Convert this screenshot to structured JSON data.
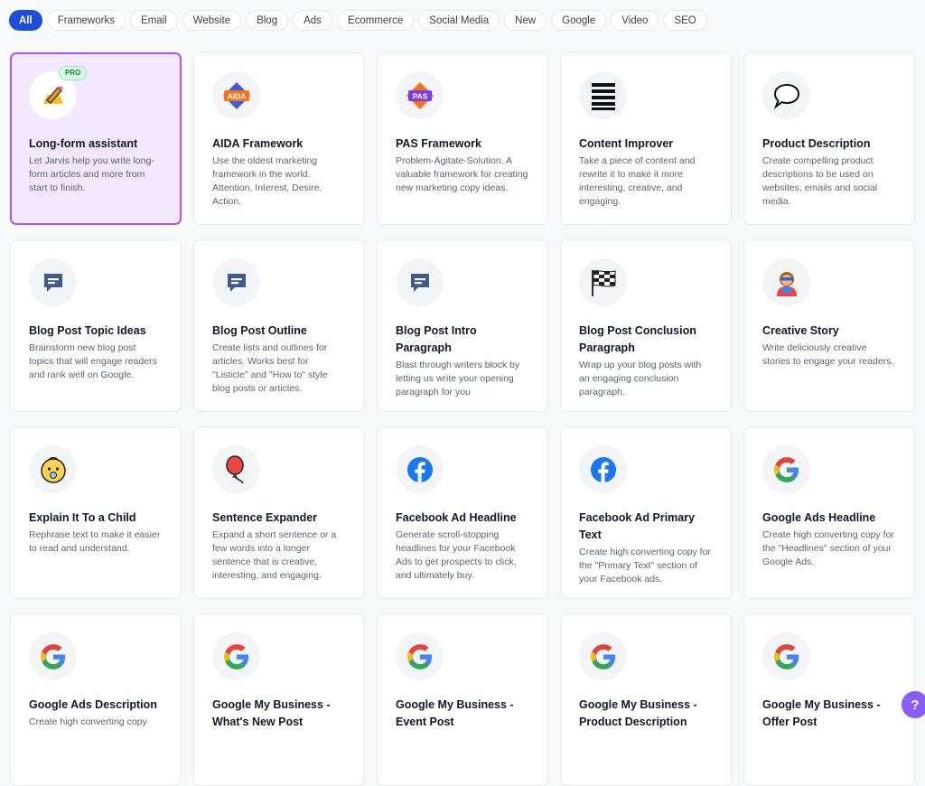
{
  "filters": [
    "All",
    "Frameworks",
    "Email",
    "Website",
    "Blog",
    "Ads",
    "Ecommerce",
    "Social Media",
    "New",
    "Google",
    "Video",
    "SEO"
  ],
  "active_filter": 0,
  "pro_badge": "PRO",
  "help_label": "?",
  "icon_labels": {
    "aida": "AIDA",
    "pas": "PAS"
  },
  "cards": [
    {
      "title": "Long-form assistant",
      "desc": "Let Jarvis help you write long-form articles and more from start to finish.",
      "icon": "pencil-icon",
      "pro": true,
      "selected": true
    },
    {
      "title": "AIDA Framework",
      "desc": "Use the oldest marketing framework in the world. Attention, Interest, Desire, Action.",
      "icon": "aida-icon"
    },
    {
      "title": "PAS Framework",
      "desc": "Problem-Agitate-Solution. A valuable framework for creating new marketing copy ideas.",
      "icon": "pas-icon"
    },
    {
      "title": "Content Improver",
      "desc": "Take a piece of content and rewrite it to make it more interesting, creative, and engaging.",
      "icon": "lines-icon"
    },
    {
      "title": "Product Description",
      "desc": "Create compelling product descriptions to be used on websites, emails and social media.",
      "icon": "speech-bubble-icon"
    },
    {
      "title": "Blog Post Topic Ideas",
      "desc": "Brainstorm new blog post topics that will engage readers and rank well on Google.",
      "icon": "message-icon"
    },
    {
      "title": "Blog Post Outline",
      "desc": "Create lists and outlines for articles. Works best for \"Listicle\" and \"How to\" style blog posts or articles.",
      "icon": "message-icon"
    },
    {
      "title": "Blog Post Intro Paragraph",
      "desc": "Blast through writers block by letting us write your opening paragraph for you",
      "icon": "message-icon"
    },
    {
      "title": "Blog Post Conclusion Paragraph",
      "desc": "Wrap up your blog posts with an engaging conclusion paragraph.",
      "icon": "checkered-flag-icon"
    },
    {
      "title": "Creative Story",
      "desc": "Write deliciously creative stories to engage your readers.",
      "icon": "superhero-icon"
    },
    {
      "title": "Explain It To a Child",
      "desc": "Rephrase text to make it easier to read and understand.",
      "icon": "baby-icon"
    },
    {
      "title": "Sentence Expander",
      "desc": "Expand a short sentence or a few words into a longer sentence that is creative, interesting, and engaging.",
      "icon": "balloon-icon"
    },
    {
      "title": "Facebook Ad Headline",
      "desc": "Generate scroll-stopping headlines for your Facebook Ads to get prospects to click, and ultimately buy.",
      "icon": "facebook-icon"
    },
    {
      "title": "Facebook Ad Primary Text",
      "desc": "Create high converting copy for the \"Primary Text\" section of your Facebook ads.",
      "icon": "facebook-icon"
    },
    {
      "title": "Google Ads Headline",
      "desc": "Create high converting copy for the \"Headlines\" section of your Google Ads.",
      "icon": "google-icon"
    },
    {
      "title": "Google Ads Description",
      "desc": "Create high converting copy",
      "icon": "google-icon"
    },
    {
      "title": "Google My Business - What's New Post",
      "desc": "",
      "icon": "google-icon"
    },
    {
      "title": "Google My Business - Event Post",
      "desc": "",
      "icon": "google-icon"
    },
    {
      "title": "Google My Business - Product Description",
      "desc": "",
      "icon": "google-icon"
    },
    {
      "title": "Google My Business - Offer Post",
      "desc": "",
      "icon": "google-icon"
    }
  ]
}
